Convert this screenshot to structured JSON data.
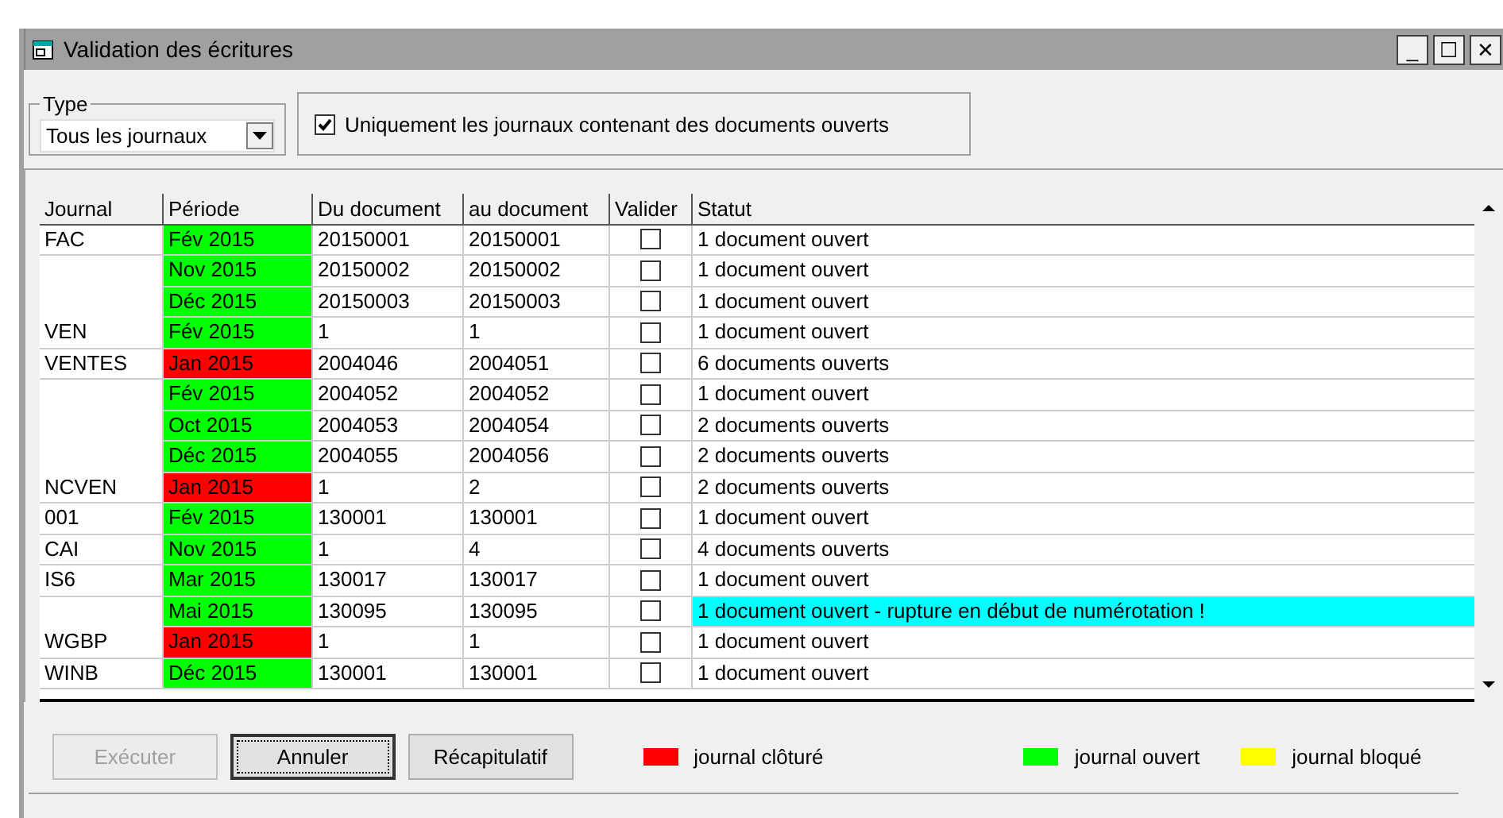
{
  "window": {
    "title": "Validation des écritures",
    "controls": [
      "_",
      "☐",
      "✕"
    ]
  },
  "type_group": {
    "legend": "Type",
    "value": "Tous les journaux"
  },
  "filter": {
    "label": "Uniquement les journaux contenant des documents ouverts",
    "checked": true
  },
  "table": {
    "columns": [
      "Journal",
      "Période",
      "Du document",
      "au document",
      "Valider",
      "Statut"
    ],
    "rows": [
      {
        "journal": "FAC",
        "period": "Fév 2015",
        "color": "#00ff00",
        "from": "20150001",
        "to": "20150001",
        "checked": false,
        "status": "1 document ouvert",
        "highlighted": false
      },
      {
        "period": "Nov 2015",
        "color": "#00ff00",
        "from": "20150002",
        "to": "20150002",
        "checked": false,
        "status": "1 document ouvert",
        "highlighted": false
      },
      {
        "period": "Déc 2015",
        "color": "#00ff00",
        "from": "20150003",
        "to": "20150003",
        "checked": false,
        "status": "1 document ouvert",
        "highlighted": false
      },
      {
        "journal": "VEN",
        "period": "Fév 2015",
        "color": "#00ff00",
        "from": "1",
        "to": "1",
        "checked": false,
        "status": "1 document ouvert",
        "highlighted": false
      },
      {
        "journal": "VENTES",
        "period": "Jan 2015",
        "color": "#ff0000",
        "from": "2004046",
        "to": "2004051",
        "checked": false,
        "status": "6 documents ouverts",
        "highlighted": false
      },
      {
        "period": "Fév 2015",
        "color": "#00ff00",
        "from": "2004052",
        "to": "2004052",
        "checked": false,
        "status": "1 document ouvert",
        "highlighted": false
      },
      {
        "period": "Oct 2015",
        "color": "#00ff00",
        "from": "2004053",
        "to": "2004054",
        "checked": false,
        "status": "2 documents ouverts",
        "highlighted": false
      },
      {
        "period": "Déc 2015",
        "color": "#00ff00",
        "from": "2004055",
        "to": "2004056",
        "checked": false,
        "status": "2 documents ouverts",
        "highlighted": false
      },
      {
        "journal": "NCVEN",
        "period": "Jan 2015",
        "color": "#ff0000",
        "from": "1",
        "to": "2",
        "checked": false,
        "status": "2 documents ouverts",
        "highlighted": false
      },
      {
        "journal": "001",
        "period": "Fév 2015",
        "color": "#00ff00",
        "from": "130001",
        "to": "130001",
        "checked": false,
        "status": "1 document ouvert",
        "highlighted": false
      },
      {
        "journal": "CAI",
        "period": "Nov 2015",
        "color": "#00ff00",
        "from": "1",
        "to": "4",
        "checked": false,
        "status": "4 documents ouverts",
        "highlighted": false
      },
      {
        "journal": "IS6",
        "period": "Mar 2015",
        "color": "#00ff00",
        "from": "130017",
        "to": "130017",
        "checked": false,
        "status": "1 document ouvert",
        "highlighted": false
      },
      {
        "period": "Mai 2015",
        "color": "#00ff00",
        "from": "130095",
        "to": "130095",
        "checked": false,
        "status": "1 document ouvert - rupture en début de numérotation !",
        "highlighted": true
      },
      {
        "journal": "WGBP",
        "period": "Jan 2015",
        "color": "#ff0000",
        "from": "1",
        "to": "1",
        "checked": false,
        "status": "1 document ouvert",
        "highlighted": false
      },
      {
        "journal": "WINB",
        "period": "Déc 2015",
        "color": "#00ff00",
        "from": "130001",
        "to": "130001",
        "checked": false,
        "status": "1 document ouvert",
        "highlighted": false
      }
    ]
  },
  "buttons": [
    {
      "label": "Exécuter",
      "disabled": true,
      "focused": false
    },
    {
      "label": "Annuler",
      "disabled": false,
      "focused": true
    },
    {
      "label": "Récapitulatif",
      "disabled": false,
      "focused": false
    }
  ],
  "legend": [
    {
      "label": "journal clôturé",
      "color": "#ff0000"
    },
    {
      "label": "journal ouvert",
      "color": "#00ff00"
    },
    {
      "label": "journal bloqué",
      "color": "#ffff00"
    }
  ]
}
